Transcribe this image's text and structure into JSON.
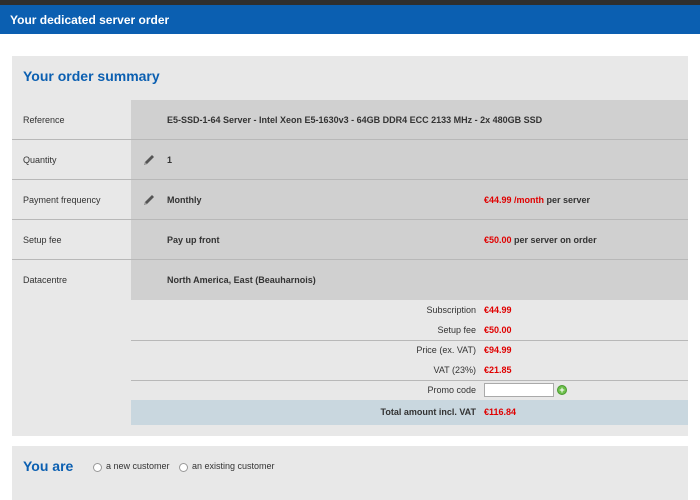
{
  "header": {
    "title": "Your dedicated server order"
  },
  "summary": {
    "title": "Your order summary",
    "rows": [
      {
        "label": "Reference",
        "value": "E5-SSD-1-64 Server - Intel Xeon E5-1630v3 - 64GB DDR4 ECC 2133 MHz - 2x 480GB SSD"
      },
      {
        "label": "Quantity",
        "value": "1",
        "icon": "pencil-icon"
      },
      {
        "label": "Payment frequency",
        "value": "Monthly",
        "icon": "pencil-icon",
        "price": "€44.99 /month",
        "price_suffix": " per server"
      },
      {
        "label": "Setup fee",
        "value": "Pay up front",
        "price": "€50.00",
        "price_suffix": " per server on order"
      },
      {
        "label": "Datacentre",
        "value": "North America, East (Beauharnois)"
      }
    ],
    "totals": {
      "subscription_label": "Subscription",
      "subscription_value": "€44.99",
      "setup_label": "Setup fee",
      "setup_value": "€50.00",
      "price_ex_vat_label": "Price (ex. VAT)",
      "price_ex_vat_value": "€94.99",
      "vat_label": "VAT (23%)",
      "vat_value": "€21.85",
      "promo_label": "Promo code",
      "promo_value": "",
      "promo_placeholder": "",
      "total_label": "Total amount incl. VAT",
      "total_value": "€116.84"
    }
  },
  "customer": {
    "title": "You are",
    "options": [
      "a new customer",
      "an existing customer"
    ]
  },
  "colors": {
    "brand": "#0b5fb1",
    "price": "#e00000",
    "panel": "#e8e8e8",
    "cell": "#d0d0d0",
    "total_bg": "#c9d7df"
  }
}
